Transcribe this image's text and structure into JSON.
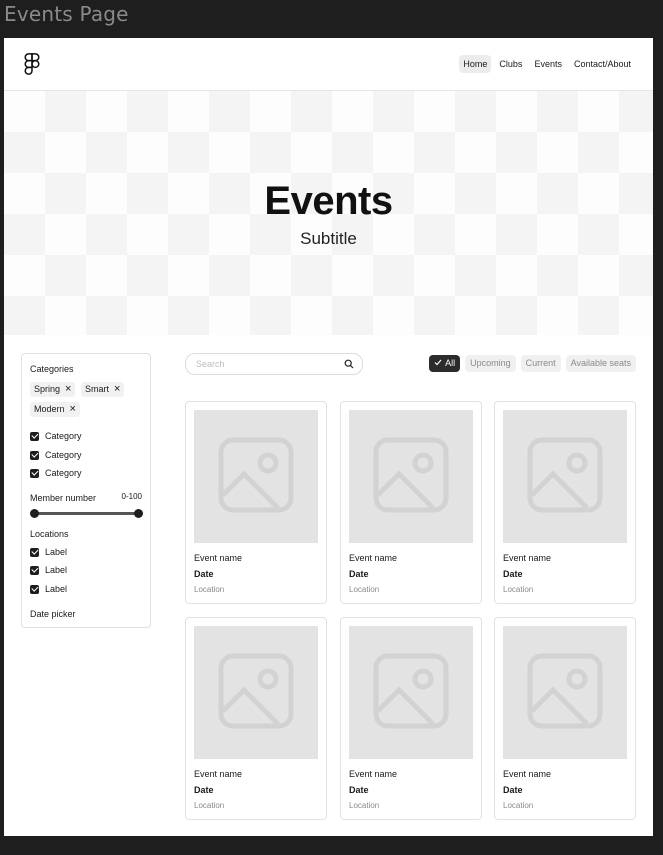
{
  "frame_title": "Events Page",
  "nav": {
    "items": [
      {
        "label": "Home",
        "active": true
      },
      {
        "label": "Clubs",
        "active": false
      },
      {
        "label": "Events",
        "active": false
      },
      {
        "label": "Contact/About",
        "active": false
      }
    ]
  },
  "hero": {
    "title": "Events",
    "subtitle": "Subtitle"
  },
  "sidebar": {
    "categories_heading": "Categories",
    "chips": [
      {
        "label": "Spring"
      },
      {
        "label": "Smart"
      },
      {
        "label": "Modern"
      }
    ],
    "category_checks": [
      {
        "label": "Category",
        "checked": true
      },
      {
        "label": "Category",
        "checked": true
      },
      {
        "label": "Category",
        "checked": true
      }
    ],
    "member_heading": "Member number",
    "member_range": "0-100",
    "member_slider": {
      "min": 0,
      "max": 100,
      "low": 0,
      "high": 100
    },
    "locations_heading": "Locations",
    "location_checks": [
      {
        "label": "Label",
        "checked": true
      },
      {
        "label": "Label",
        "checked": true
      },
      {
        "label": "Label",
        "checked": true
      }
    ],
    "date_picker_label": "Date picker"
  },
  "search": {
    "placeholder": "Search",
    "value": ""
  },
  "filters": [
    {
      "label": "All",
      "active": true
    },
    {
      "label": "Upcoming",
      "active": false
    },
    {
      "label": "Current",
      "active": false
    },
    {
      "label": "Available seats",
      "active": false
    }
  ],
  "events": [
    {
      "name": "Event name",
      "date": "Date",
      "location": "Location"
    },
    {
      "name": "Event name",
      "date": "Date",
      "location": "Location"
    },
    {
      "name": "Event name",
      "date": "Date",
      "location": "Location"
    },
    {
      "name": "Event name",
      "date": "Date",
      "location": "Location"
    },
    {
      "name": "Event name",
      "date": "Date",
      "location": "Location"
    },
    {
      "name": "Event name",
      "date": "Date",
      "location": "Location"
    }
  ],
  "colors": {
    "canvas": "#1e1e1e",
    "accent_dark": "#2c2c2c",
    "placeholder_gray": "#e3e3e3"
  }
}
